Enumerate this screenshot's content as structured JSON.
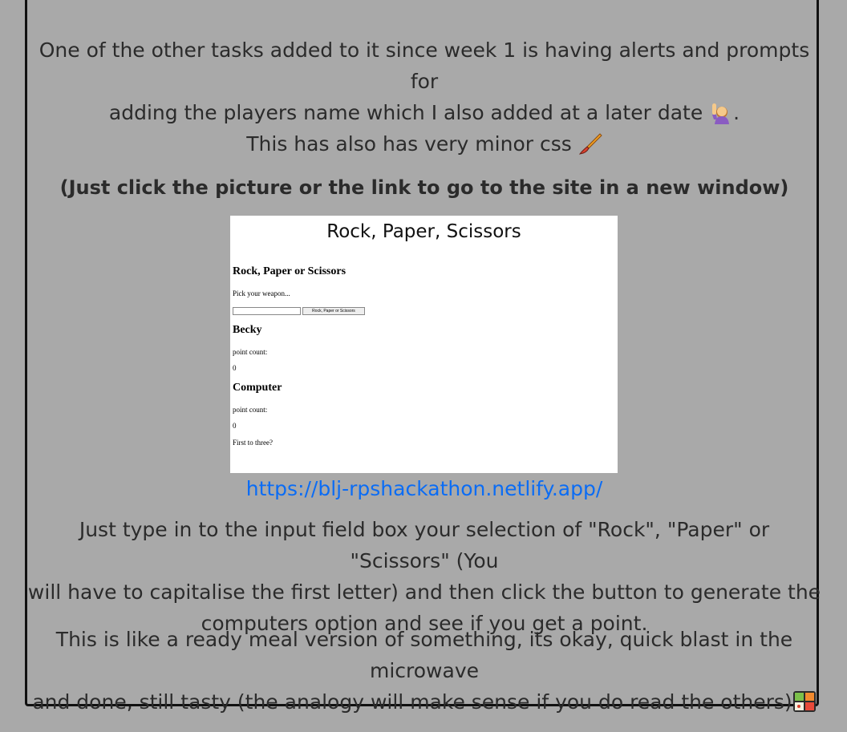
{
  "post": {
    "para1_line1": "One of the other tasks added to it since week 1 is having alerts and prompts for",
    "para1_line2": "adding the players name which I also added at a later date",
    "para1_end": ".",
    "para2": "This has also has very minor css",
    "para3": "(Just click the picture or the link to go to the site in a new window)",
    "link_text": "https://blj-rpshackathon.netlify.app/",
    "para4_line1": "Just type in to the input field box your selection of \"Rock\", \"Paper\" or \"Scissors\" (You",
    "para4_line2": "will have to capitalise the first letter) and then click the button to generate the",
    "para4_line3": "computers option and see if you get a point.",
    "para5_line1": "This is like a ready meal version of something, its okay, quick blast in the microwave",
    "para5_line2": "and done, still tasty (the analogy will make sense if you do read the others)"
  },
  "preview": {
    "title": "Rock, Paper, Scissors",
    "heading": "Rock, Paper or Scissors",
    "prompt": "Pick your weapon...",
    "button": "Rock, Paper or Scissors",
    "player_name": "Becky",
    "player_label": "point count:",
    "player_score": "0",
    "computer_name": "Computer",
    "computer_label": "point count:",
    "computer_score": "0",
    "footer": "First to three?"
  },
  "icons": {
    "raising_hand": "person-raising-hand-icon",
    "paintbrush": "paintbrush-icon",
    "bento": "bento-box-icon"
  },
  "colors": {
    "background": "#a9a9a9",
    "border": "#111111",
    "link": "#0a6cf5",
    "text": "#2b2b2b"
  }
}
